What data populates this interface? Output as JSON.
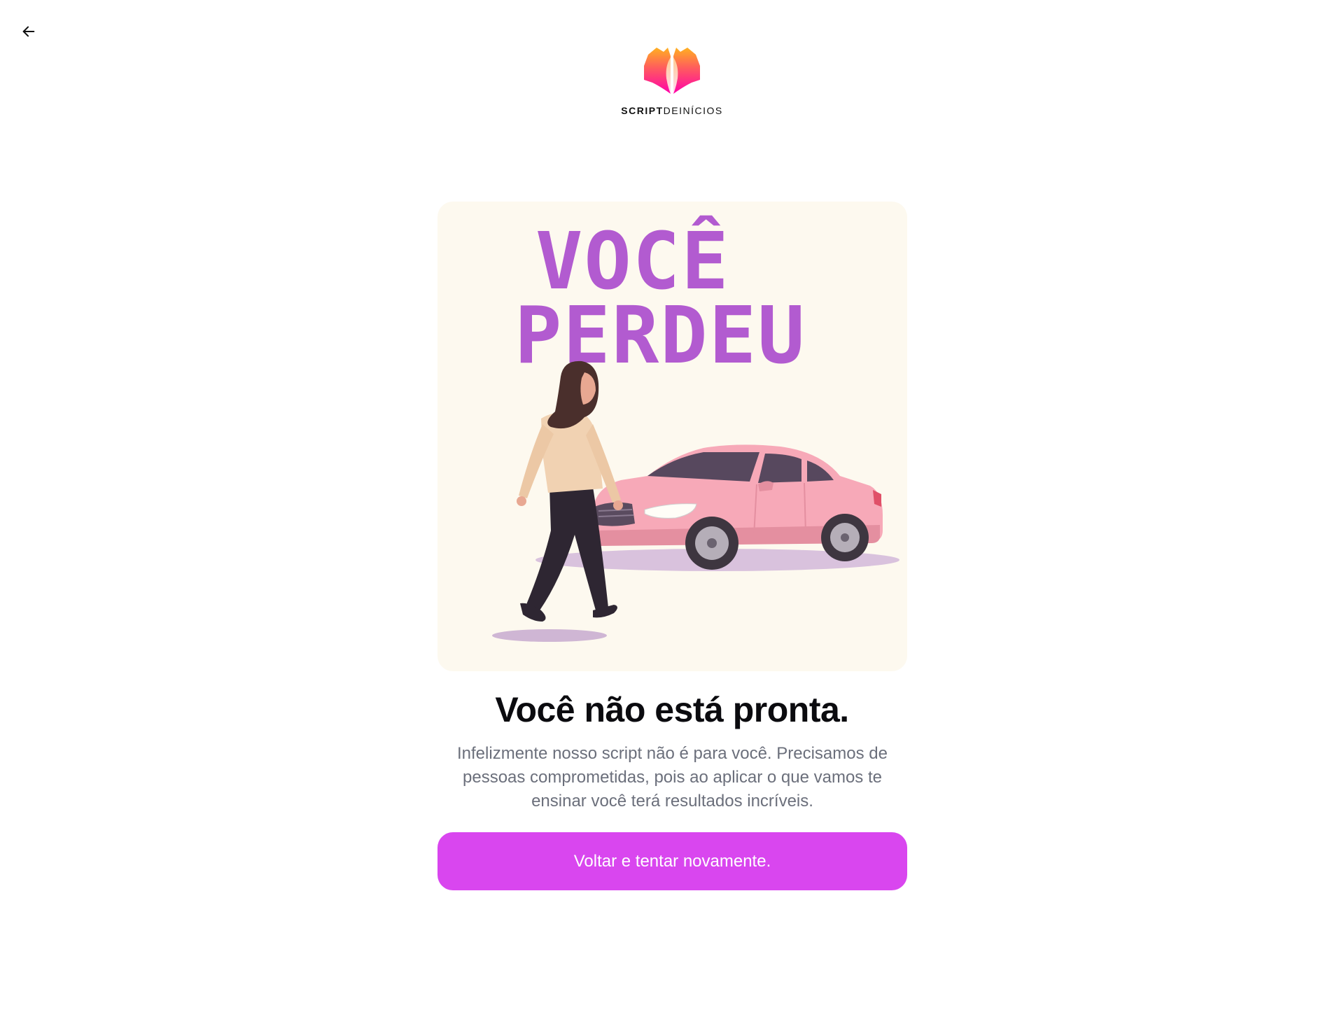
{
  "nav": {
    "back_icon": "arrow-left-icon"
  },
  "brand": {
    "logo_icon": "scriptdeinicios-logo",
    "wordmark_bold": "SCRIPT",
    "wordmark_regular": "DEINÍCIOS",
    "logo_colors": [
      "#ffb020",
      "#ff2d9b",
      "#ff00aa"
    ]
  },
  "hero": {
    "title_line_1": "VOCÊ",
    "title_line_2": "PERDEU",
    "title_color": "#b25bd0",
    "background_color": "#fdf9ef",
    "illustration": "woman-walking-away-from-pink-car"
  },
  "result": {
    "headline": "Você não está pronta.",
    "description": "Infelizmente nosso script não é para você. Precisamos de pessoas comprometidas, pois ao aplicar o que vamos te ensinar você terá resultados incríveis."
  },
  "actions": {
    "retry_label": "Voltar e tentar novamente.",
    "retry_color": "#d946ef"
  }
}
